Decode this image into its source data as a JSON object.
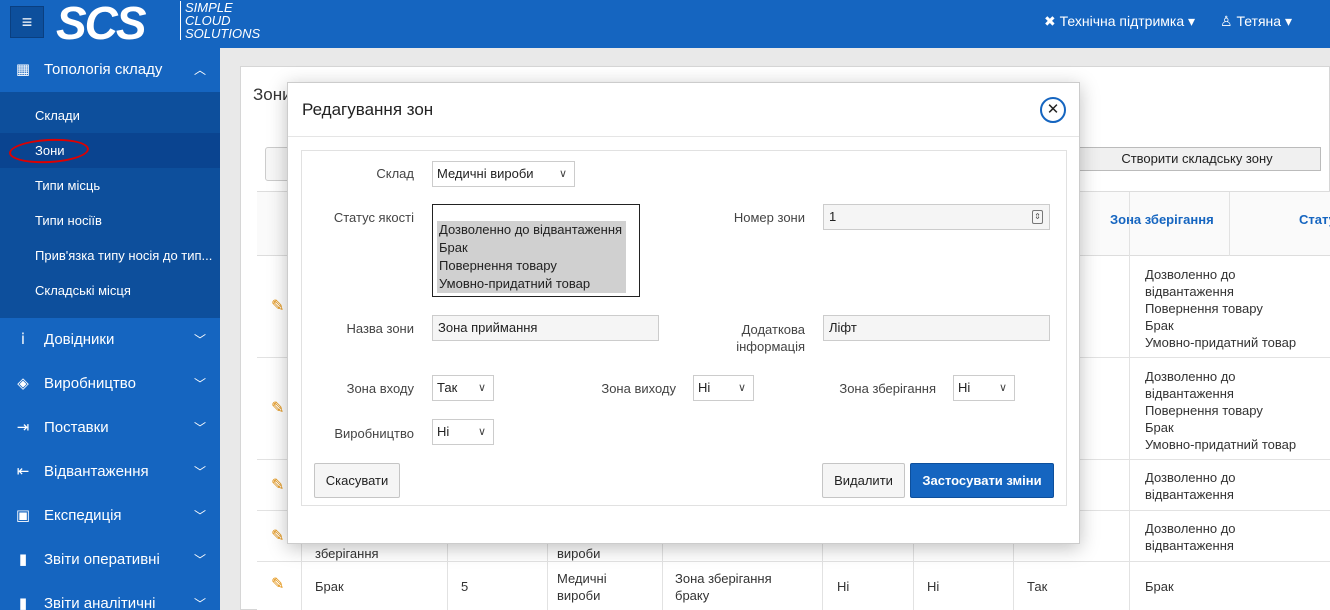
{
  "header": {
    "logo_mark": "SCS",
    "logo_text": [
      "SIMPLE",
      "CLOUD",
      "SOLUTIONS"
    ],
    "support_label": "Технічна підтримка",
    "user_label": "Тетяна"
  },
  "sidebar": {
    "groups": [
      {
        "label": "Топологія складу",
        "icon": "building-icon"
      },
      {
        "label": "Довідники",
        "icon": "info-icon"
      },
      {
        "label": "Виробництво",
        "icon": "cube-icon"
      },
      {
        "label": "Поставки",
        "icon": "sign-in-icon"
      },
      {
        "label": "Відвантаження",
        "icon": "sign-out-icon"
      },
      {
        "label": "Експедиція",
        "icon": "truck-icon"
      },
      {
        "label": "Звіти оперативні",
        "icon": "bar-chart-icon"
      },
      {
        "label": "Звіти аналітичні",
        "icon": "bar-chart-icon"
      }
    ],
    "sub_items": [
      "Склади",
      "Зони",
      "Типи місць",
      "Типи носіїв",
      "Прив'язка типу носія до тип...",
      "Складські місця"
    ]
  },
  "background": {
    "page_title": "Зони",
    "create_button": "Створити складську зону",
    "columns": {
      "storage_zone": "Зона зберігання",
      "status": "Стату"
    },
    "status_cells": [
      "Дозволенно до відвантаження\nПовернення товару\nБрак\nУмовно-придатний товар",
      "Дозволенно до відвантаження\nПовернення товару\nБрак\nУмовно-придатний товар",
      "Дозволенно до відвантаження",
      "Дозволенно до відвантаження",
      "Брак"
    ],
    "row4_partial": {
      "zone_name": "зберігання",
      "warehouse": "вироби"
    },
    "row5": {
      "quality": "Брак",
      "number": "5",
      "warehouse": "Медичні вироби",
      "zone_name": "Зона зберігання браку",
      "entry": "Ні",
      "exit": "Ні",
      "storage": "Так",
      "status": "Брак"
    }
  },
  "modal": {
    "title": "Редагування зон",
    "labels": {
      "warehouse": "Склад",
      "quality_status": "Статус якості",
      "zone_number": "Номер зони",
      "zone_name": "Назва зони",
      "additional_info": "Додаткова інформація",
      "entry_zone": "Зона входу",
      "exit_zone": "Зона виходу",
      "storage_zone": "Зона зберігання",
      "production": "Виробництво"
    },
    "values": {
      "warehouse": "Медичні вироби",
      "quality_status": [
        "Дозволенно до відвантаження",
        "Брак",
        "Повернення товару",
        "Умовно-придатний товар"
      ],
      "zone_number": "1",
      "zone_name": "Зона приймання",
      "additional_info": "Ліфт",
      "entry_zone": "Так",
      "exit_zone": "Ні",
      "storage_zone": "Ні",
      "production": "Ні"
    },
    "buttons": {
      "cancel": "Скасувати",
      "delete": "Видалити",
      "apply": "Застосувати зміни"
    }
  }
}
